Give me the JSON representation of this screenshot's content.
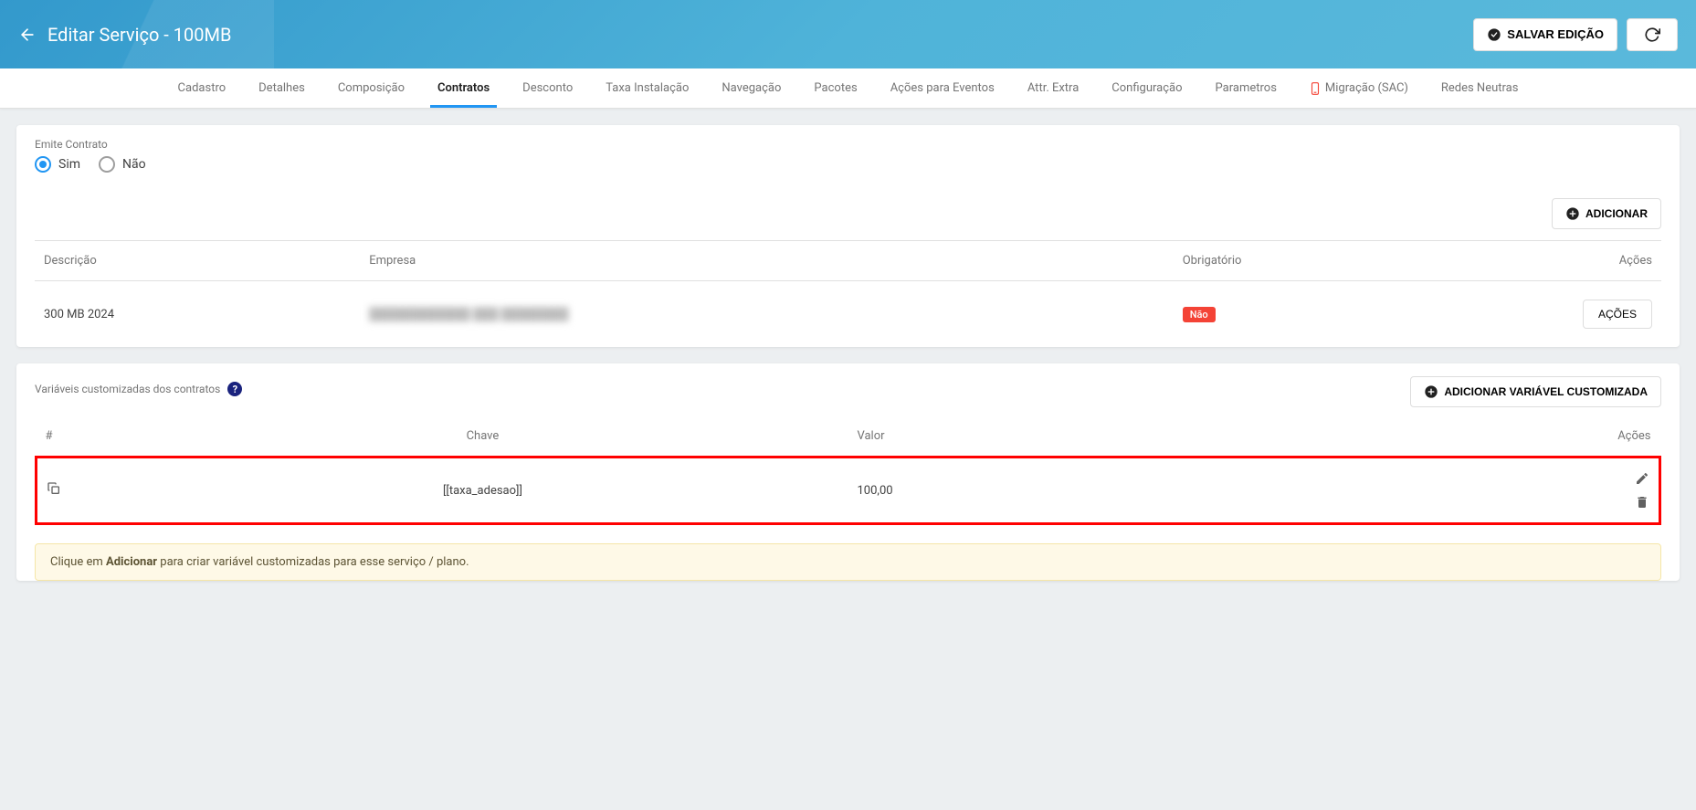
{
  "header": {
    "title": "Editar Serviço - 100MB",
    "save_label": "SALVAR EDIÇÃO"
  },
  "tabs": [
    {
      "label": "Cadastro"
    },
    {
      "label": "Detalhes"
    },
    {
      "label": "Composição"
    },
    {
      "label": "Contratos",
      "active": true
    },
    {
      "label": "Desconto"
    },
    {
      "label": "Taxa Instalação"
    },
    {
      "label": "Navegação"
    },
    {
      "label": "Pacotes"
    },
    {
      "label": "Ações para Eventos"
    },
    {
      "label": "Attr. Extra"
    },
    {
      "label": "Configuração"
    },
    {
      "label": "Parametros"
    },
    {
      "label": "Migração (SAC)",
      "icon": "phone"
    },
    {
      "label": "Redes Neutras"
    }
  ],
  "contract_panel": {
    "emit_label": "Emite Contrato",
    "radio_yes": "Sim",
    "radio_no": "Não",
    "emit_value": "sim",
    "add_button": "ADICIONAR",
    "columns": {
      "descricao": "Descrição",
      "empresa": "Empresa",
      "obrigatorio": "Obrigatório",
      "acoes": "Ações"
    },
    "rows": [
      {
        "descricao": "300 MB 2024",
        "empresa": "",
        "obrigatorio": "Não",
        "acao_label": "AÇÕES"
      }
    ]
  },
  "variables_panel": {
    "title": "Variáveis customizadas dos contratos",
    "add_button": "ADICIONAR VARIÁVEL CUSTOMIZADA",
    "columns": {
      "hash": "#",
      "chave": "Chave",
      "valor": "Valor",
      "acoes": "Ações"
    },
    "rows": [
      {
        "chave": "[[taxa_adesao]]",
        "valor": "100,00"
      }
    ],
    "info_prefix": "Clique em ",
    "info_bold": "Adicionar",
    "info_suffix": " para criar variável customizadas para esse serviço / plano."
  }
}
